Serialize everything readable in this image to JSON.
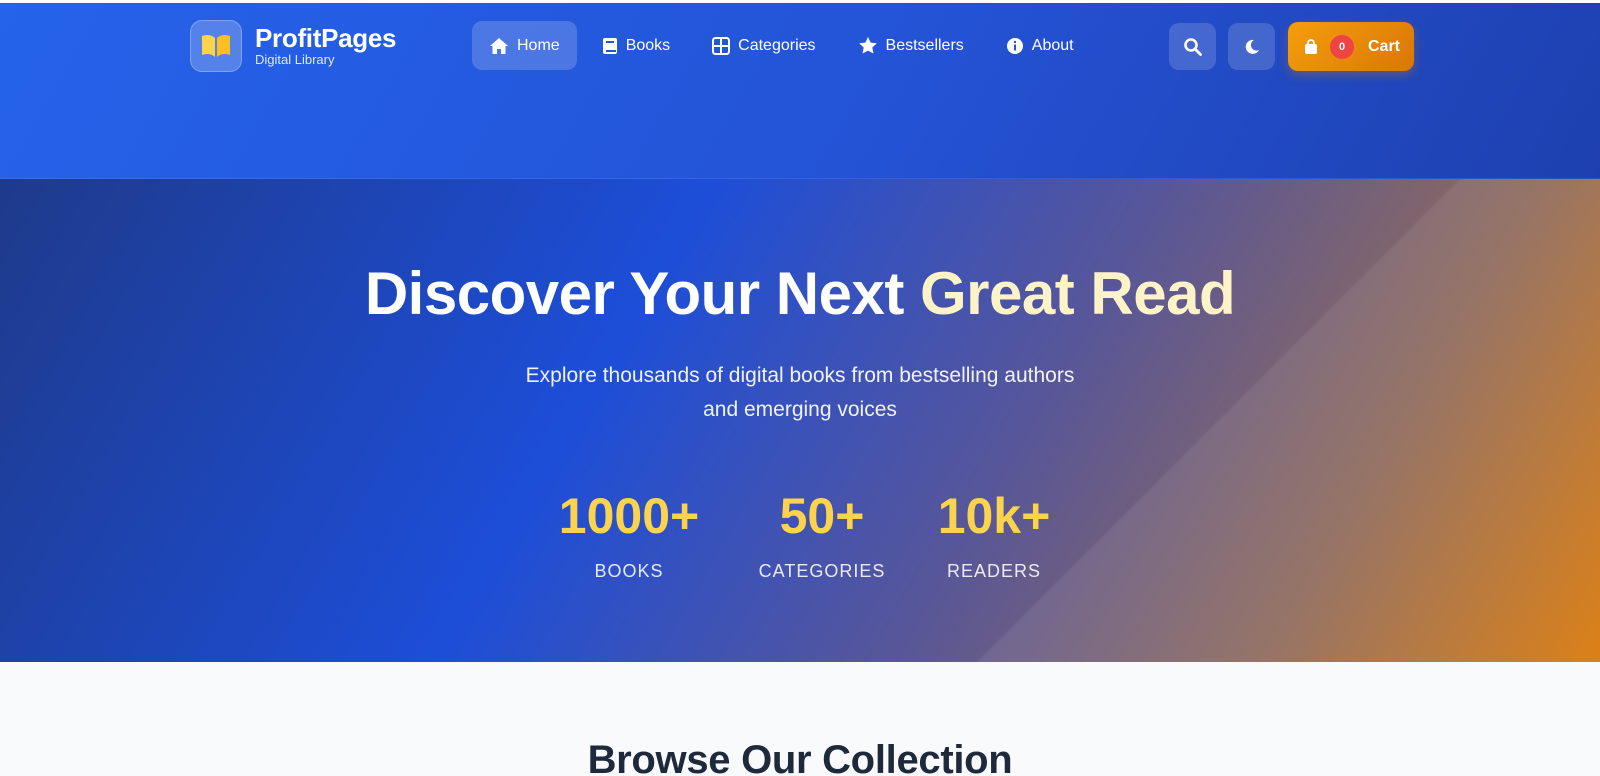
{
  "brand": {
    "name": "ProfitPages",
    "subtitle": "Digital Library",
    "logo_icon": "open-book-icon"
  },
  "nav": {
    "items": [
      {
        "label": "Home",
        "icon": "home-icon",
        "active": true
      },
      {
        "label": "Books",
        "icon": "book-icon",
        "active": false
      },
      {
        "label": "Categories",
        "icon": "grid-icon",
        "active": false
      },
      {
        "label": "Bestsellers",
        "icon": "star-icon",
        "active": false
      },
      {
        "label": "About",
        "icon": "info-icon",
        "active": false
      }
    ]
  },
  "header_actions": {
    "search_icon": "search-icon",
    "theme_icon": "moon-icon",
    "cart": {
      "label": "Cart",
      "count": "0",
      "icon": "shopping-bag-icon"
    }
  },
  "hero": {
    "title_part1": "Discover Your Next",
    "title_part2": "Great Read",
    "subtitle_line1": "Explore thousands of digital books from bestselling authors",
    "subtitle_line2": "and emerging voices",
    "stats": [
      {
        "value": "1000+",
        "label": "BOOKS"
      },
      {
        "value": "50+",
        "label": "CATEGORIES"
      },
      {
        "value": "10k+",
        "label": "READERS"
      }
    ]
  },
  "section": {
    "title": "Browse Our Collection"
  },
  "colors": {
    "primary": "#2563eb",
    "accent": "#f59e0b",
    "stat": "#fcd34d",
    "badge": "#ef4444"
  }
}
